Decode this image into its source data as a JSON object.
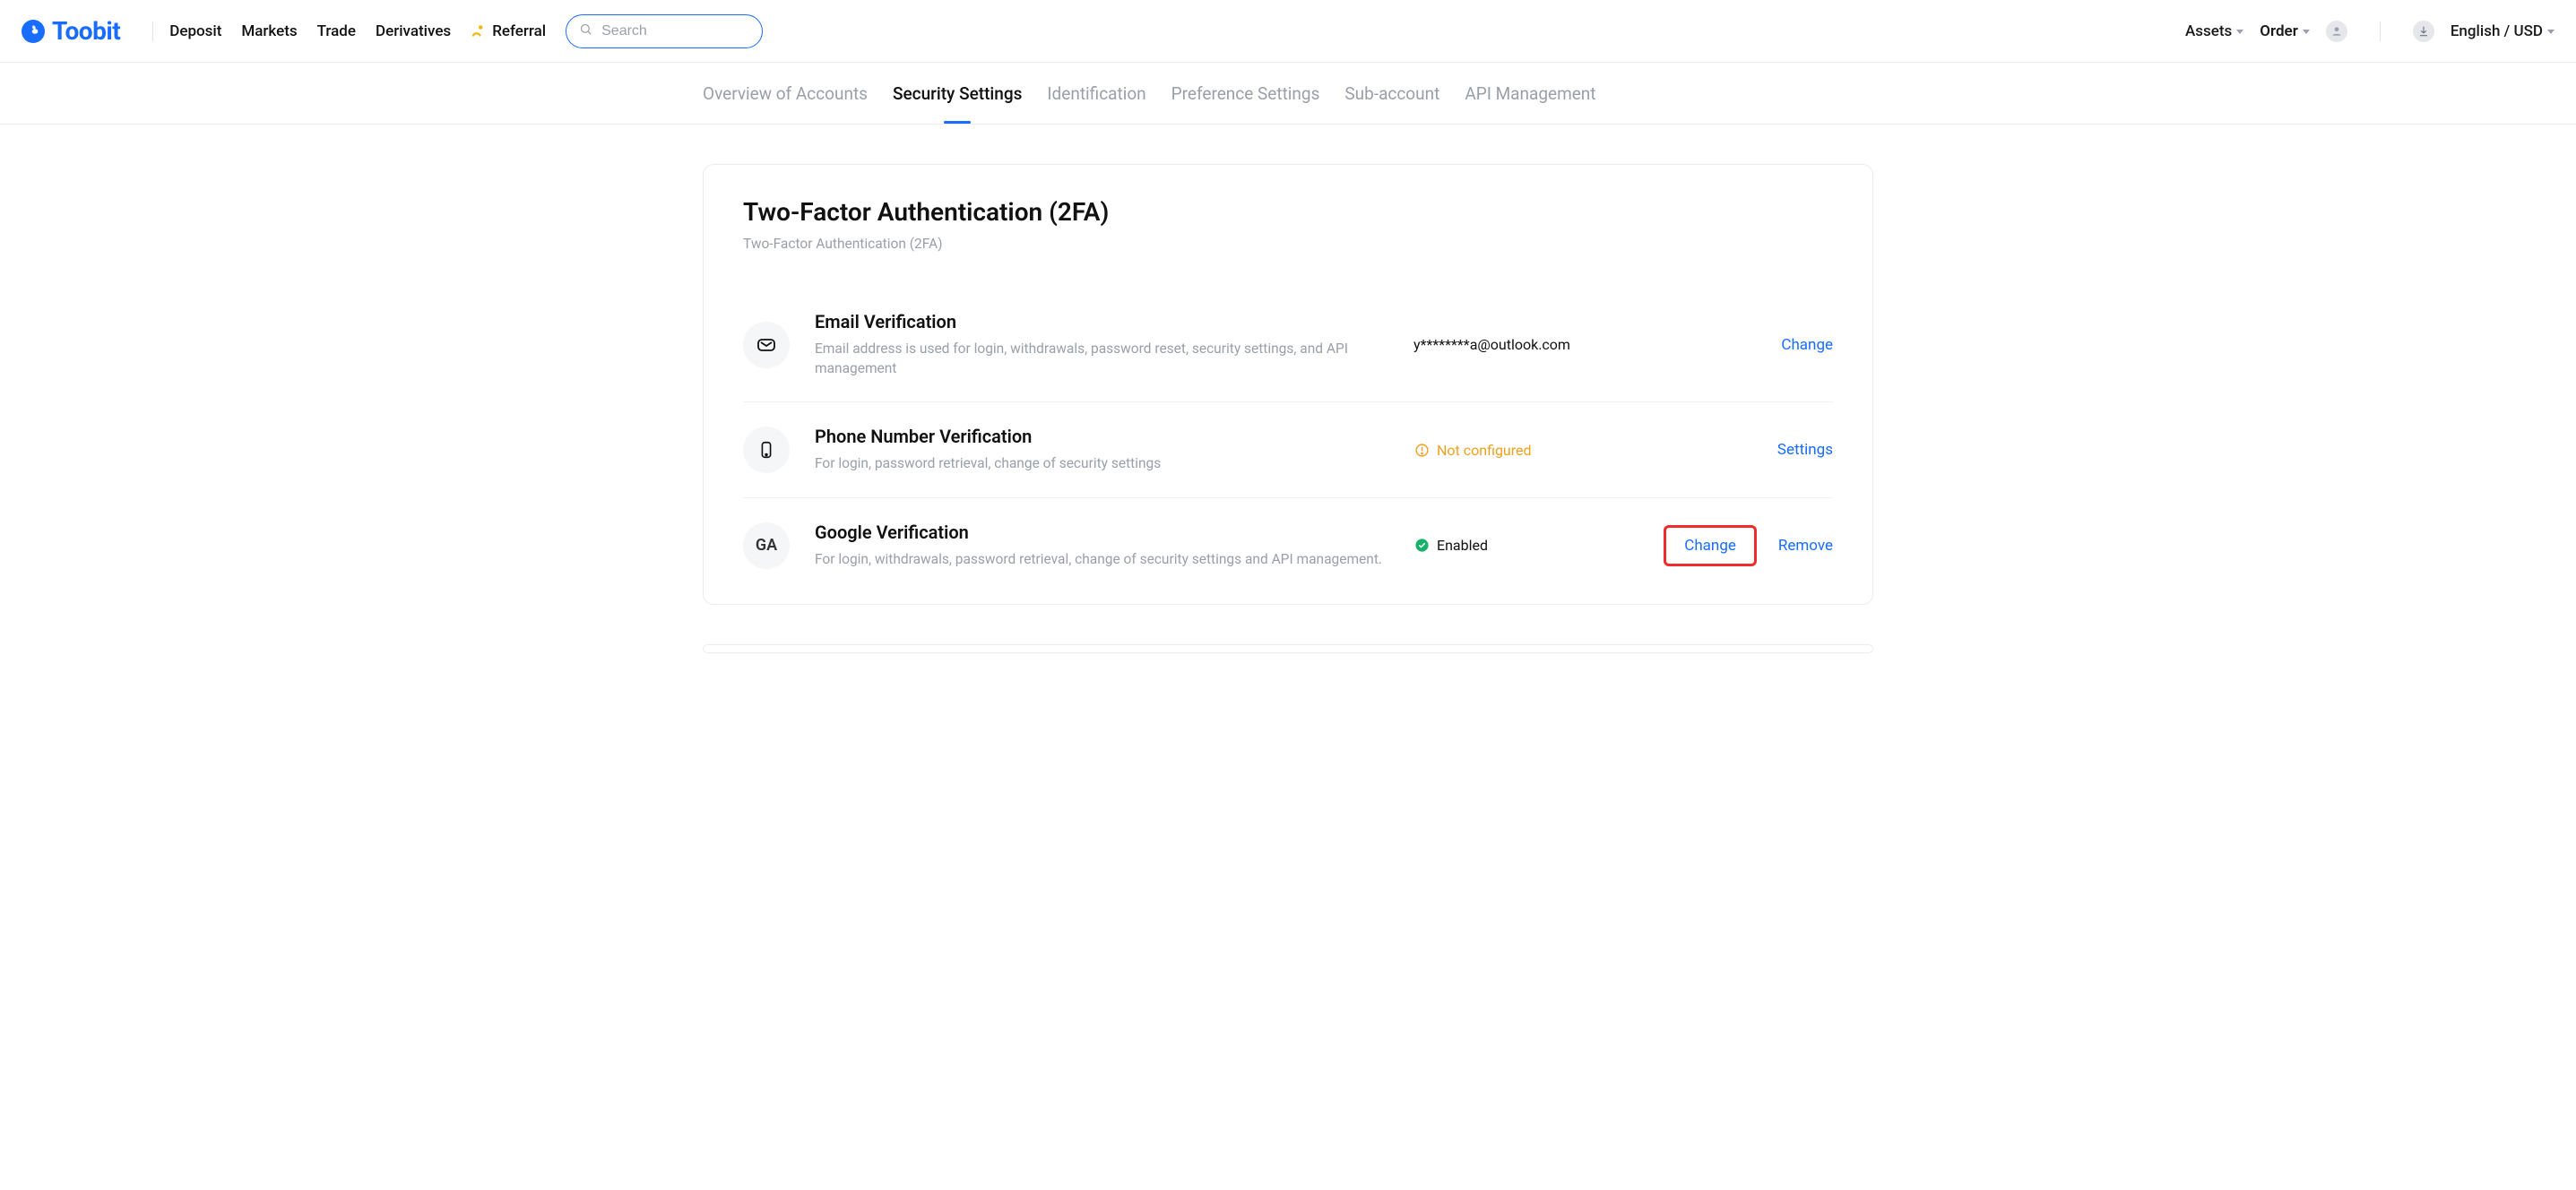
{
  "brand": "Toobit",
  "nav": {
    "deposit": "Deposit",
    "markets": "Markets",
    "trade": "Trade",
    "derivatives": "Derivatives",
    "referral": "Referral"
  },
  "search": {
    "placeholder": "Search"
  },
  "top": {
    "assets": "Assets",
    "order": "Order",
    "lang": "English / USD"
  },
  "tabs": {
    "overview": "Overview of Accounts",
    "security": "Security Settings",
    "identification": "Identification",
    "preference": "Preference Settings",
    "subaccount": "Sub-account",
    "api": "API Management"
  },
  "tfa": {
    "title": "Two-Factor Authentication (2FA)",
    "subtitle": "Two-Factor Authentication (2FA)",
    "rows": {
      "email": {
        "title": "Email Verification",
        "desc": "Email address is used for login, withdrawals, password reset, security settings, and API management",
        "value": "y********a@outlook.com",
        "action": "Change"
      },
      "phone": {
        "title": "Phone Number Verification",
        "desc": "For login, password retrieval, change of security settings",
        "status": "Not configured",
        "action": "Settings"
      },
      "google": {
        "title": "Google Verification",
        "desc": "For login, withdrawals, password retrieval, change of security settings and API management.",
        "status": "Enabled",
        "icon_text": "GA",
        "change": "Change",
        "remove": "Remove"
      }
    }
  }
}
